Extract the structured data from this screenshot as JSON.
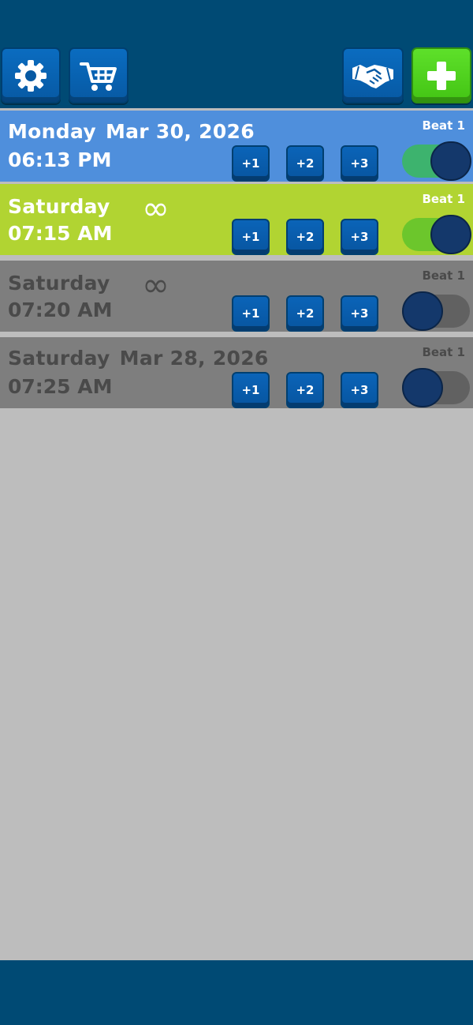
{
  "toolbar": {
    "settings_icon": "gear-icon",
    "shop_icon": "shopping-cart-icon",
    "partners_icon": "handshake-icon",
    "add_icon": "plus-icon"
  },
  "colors": {
    "row_blue": "#4f8fdc",
    "row_lime": "#b1d432",
    "row_off": "#7e7e7e",
    "toggle_on_blue": "#3db36e",
    "toggle_on_lime": "#6cc62c",
    "toggle_off": "#616161"
  },
  "alarms": [
    {
      "day": "Monday",
      "date": "Mar 30, 2026",
      "time": "06:13 PM",
      "repeat_symbol": "",
      "beat": "Beat 1",
      "snooze": [
        "+1",
        "+2",
        "+3"
      ],
      "enabled": true
    },
    {
      "day": "Saturday",
      "date": "",
      "time": "07:15 AM",
      "repeat_symbol": "∞",
      "beat": "Beat 1",
      "snooze": [
        "+1",
        "+2",
        "+3"
      ],
      "enabled": true
    },
    {
      "day": "Saturday",
      "date": "",
      "time": "07:20 AM",
      "repeat_symbol": "∞",
      "beat": "Beat 1",
      "snooze": [
        "+1",
        "+2",
        "+3"
      ],
      "enabled": false
    },
    {
      "day": "Saturday",
      "date": "Mar 28, 2026",
      "time": "07:25 AM",
      "repeat_symbol": "",
      "beat": "Beat 1",
      "snooze": [
        "+1",
        "+2",
        "+3"
      ],
      "enabled": false
    }
  ]
}
